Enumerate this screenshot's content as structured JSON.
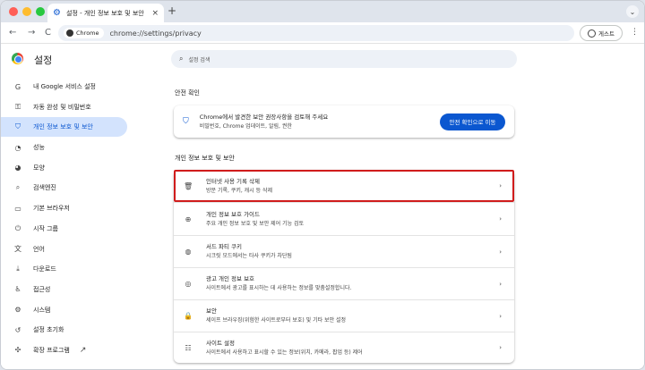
{
  "tab": {
    "title": "설정 - 개인 정보 보호 및 보안",
    "close": "×",
    "new": "+"
  },
  "toolbar": {
    "back": "←",
    "forward": "→",
    "reload": "C",
    "site_chip": "Chrome",
    "url": "chrome://settings/privacy",
    "guest": "게스트",
    "menu": "⋮",
    "tablist": "⌄"
  },
  "header": {
    "title": "설정",
    "search_placeholder": "설정 검색"
  },
  "sidebar": {
    "items": [
      {
        "icon": "G",
        "label": "내 Google 서비스 설정"
      },
      {
        "icon": "⚿",
        "label": "자동 완성 및 비밀번호"
      },
      {
        "icon": "⛉",
        "label": "개인 정보 보호 및 보안"
      },
      {
        "icon": "◔",
        "label": "성능"
      },
      {
        "icon": "◕",
        "label": "모양"
      },
      {
        "icon": "⌕",
        "label": "검색엔진"
      },
      {
        "icon": "▭",
        "label": "기본 브라우저"
      },
      {
        "icon": "⏻",
        "label": "시작 그룹"
      },
      {
        "icon": "文",
        "label": "언어"
      },
      {
        "icon": "⤓",
        "label": "다운로드"
      },
      {
        "icon": "♿",
        "label": "접근성"
      },
      {
        "icon": "⚙",
        "label": "시스템"
      },
      {
        "icon": "↺",
        "label": "설정 초기화"
      },
      {
        "icon": "✣",
        "label": "확장 프로그램",
        "ext": "↗"
      }
    ]
  },
  "safety": {
    "section_title": "안전 확인",
    "title": "Chrome에서 발견한 보안 권장사항을 검토해 주세요",
    "subtitle": "비밀번호, Chrome 업데이트, 알림, 권한",
    "button": "안전 확인으로 이동"
  },
  "privacy": {
    "section_title": "개인 정보 보호 및 보안",
    "rows": [
      {
        "icon": "🗑",
        "title": "인터넷 사용 기록 삭제",
        "subtitle": "방문 기록, 쿠키, 캐시 등 삭제"
      },
      {
        "icon": "⊕",
        "title": "개인 정보 보호 가이드",
        "subtitle": "주요 개인 정보 보호 및 보안 제어 기능 검토"
      },
      {
        "icon": "◍",
        "title": "서드 파티 쿠키",
        "subtitle": "시크릿 모드에서는 타사 쿠키가 차단됨"
      },
      {
        "icon": "◎",
        "title": "광고 개인 정보 보호",
        "subtitle": "사이트에서 광고를 표시하는 데 사용하는 정보를 맞춤설정합니다."
      },
      {
        "icon": "🔒",
        "title": "보안",
        "subtitle": "세이프 브라우징(위험한 사이트로부터 보호) 및 기타 보안 설정"
      },
      {
        "icon": "☷",
        "title": "사이트 설정",
        "subtitle": "사이트에서 사용하고 표시할 수 있는 정보(위치, 카메라, 팝업 등) 제어"
      }
    ],
    "chevron": "›"
  }
}
